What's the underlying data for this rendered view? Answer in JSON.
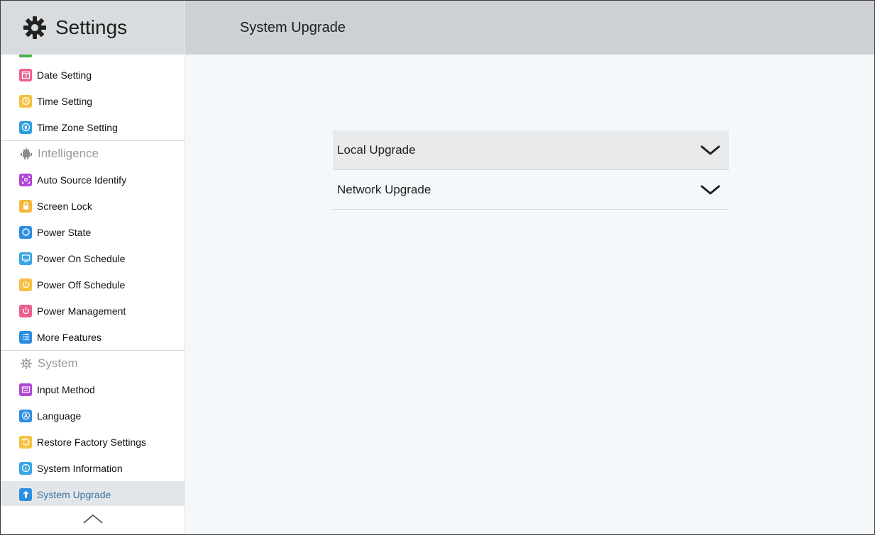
{
  "app": {
    "title": "Settings"
  },
  "page": {
    "title": "System Upgrade"
  },
  "sidebar": {
    "group1": [
      {
        "label": "Date Setting",
        "icon": "calendar-icon",
        "color": "#ec5f8d"
      },
      {
        "label": "Time Setting",
        "icon": "clock-icon",
        "color": "#f5c242"
      },
      {
        "label": "Time Zone Setting",
        "icon": "location-icon",
        "color": "#2f9fe0"
      }
    ],
    "section_intelligence": "Intelligence",
    "group2": [
      {
        "label": "Auto Source Identify",
        "icon": "scan-icon",
        "color": "#b245d6"
      },
      {
        "label": "Screen Lock",
        "icon": "lock-icon",
        "color": "#f5b83a"
      },
      {
        "label": "Power State",
        "icon": "power-state-icon",
        "color": "#2c8fe0"
      },
      {
        "label": "Power On Schedule",
        "icon": "monitor-icon",
        "color": "#3aa6e6"
      },
      {
        "label": "Power Off Schedule",
        "icon": "power-icon",
        "color": "#f5c242"
      },
      {
        "label": "Power Management",
        "icon": "power-plug-icon",
        "color": "#ec5f8d"
      },
      {
        "label": "More Features",
        "icon": "list-icon",
        "color": "#2c8fe0"
      }
    ],
    "section_system": "System",
    "group3": [
      {
        "label": "Input Method",
        "icon": "keyboard-icon",
        "color": "#b245d6"
      },
      {
        "label": "Language",
        "icon": "language-icon",
        "color": "#2c8fe0"
      },
      {
        "label": "Restore Factory Settings",
        "icon": "restore-icon",
        "color": "#f5c242"
      },
      {
        "label": "System Information",
        "icon": "info-icon",
        "color": "#3aa6e6"
      },
      {
        "label": "System Upgrade",
        "icon": "upgrade-icon",
        "color": "#2c8fe0"
      }
    ]
  },
  "upgrade": {
    "local_label": "Local Upgrade",
    "network_label": "Network Upgrade"
  }
}
